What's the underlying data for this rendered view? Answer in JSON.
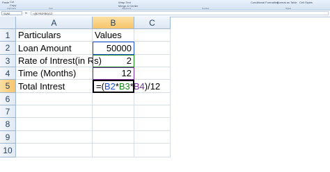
{
  "ribbon": {
    "items": [
      "Paste",
      "Cut",
      "Copy",
      "Wrap Text",
      "Merge & Center",
      "Conditional Formatting",
      "Format as Table",
      "Cell Styles"
    ],
    "groups": [
      "Clipboard",
      "Font",
      "Alignment",
      "Number",
      "Styles"
    ]
  },
  "formula_bar": {
    "name_box": "SUM",
    "fx": "fx",
    "formula": "=(B2*B3*B4)/12"
  },
  "columns": [
    "A",
    "B",
    "C"
  ],
  "rows": [
    "1",
    "2",
    "3",
    "4",
    "5",
    "6",
    "7",
    "8",
    "9",
    "10"
  ],
  "cells": {
    "A1": "Particulars",
    "B1": "Values",
    "A2": "Loan Amount",
    "B2": "50000",
    "A3": "Rate of Intrest(in Rs)",
    "B3": "2",
    "A4": "Time (Months)",
    "B4": "12",
    "A5": "Total Intrest"
  },
  "active_formula": {
    "open": "=(",
    "ref1": "B2",
    "op1": "*",
    "ref2": "B3",
    "op2": "*",
    "ref3": "B4",
    "close": ")/12"
  },
  "colors": {
    "ref_b2": "#1f4fd3",
    "ref_b3": "#1a8a1a",
    "ref_b4": "#7a2da6",
    "selected_header": "#f7c46a"
  }
}
